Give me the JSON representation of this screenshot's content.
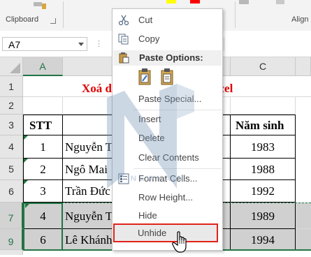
{
  "ribbon": {
    "clipboard_label": "Clipboard",
    "align_label": "Align",
    "font_colors": [
      "#ffff00",
      "#ff0000"
    ]
  },
  "formula_bar": {
    "name_box": "A7"
  },
  "columns": {
    "a": "A",
    "b": "B",
    "c": "C"
  },
  "rows": {
    "r1": "1",
    "r2": "2",
    "r3": "3",
    "r4": "4",
    "r5": "5",
    "r6": "6",
    "r7": "7",
    "r9": "9"
  },
  "sheet": {
    "title_left": "Xoá d",
    "title_right": "xcel",
    "header_stt": "STT",
    "header_year": "Năm sinh",
    "data": [
      {
        "stt": "1",
        "name": "Nguyễn T",
        "year": "1983"
      },
      {
        "stt": "2",
        "name": "Ngô Mai",
        "year": "1988"
      },
      {
        "stt": "3",
        "name": "Trần Đức",
        "year": "1992"
      },
      {
        "stt": "4",
        "name": "Nguyễn T",
        "year": "1989"
      },
      {
        "stt": "6",
        "name": "Lê Khánh Vân",
        "year": "1994"
      }
    ]
  },
  "context_menu": {
    "cut": "Cut",
    "copy": "Copy",
    "paste_options": "Paste Options:",
    "paste_special": "Paste Special...",
    "insert": "Insert",
    "delete": "Delete",
    "clear_contents": "Clear Contents",
    "format_cells": "Format Cells...",
    "row_height": "Row Height...",
    "hide": "Hide",
    "unhide": "Unhide"
  },
  "watermark": {
    "text": "NEWKAIN"
  },
  "colors": {
    "accent_green": "#217346",
    "title_red": "#e00000",
    "highlight_red": "#e2231a",
    "selected_grey": "#d0d0d0"
  }
}
